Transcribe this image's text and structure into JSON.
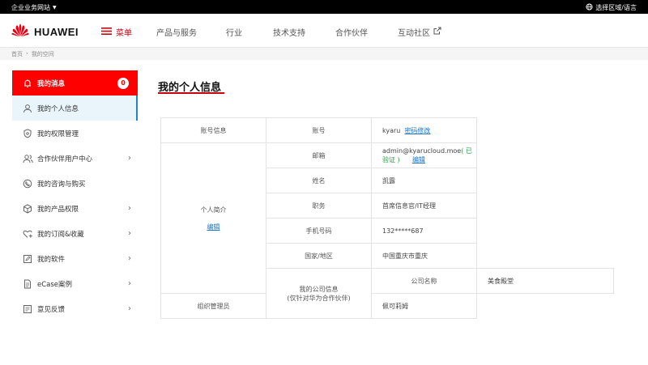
{
  "topbar": {
    "site_label": "企业业务网站",
    "region_label": "选择区域/语言"
  },
  "header": {
    "brand": "HUAWEI",
    "menu_label": "菜单",
    "nav": [
      {
        "label": "产品与服务"
      },
      {
        "label": "行业"
      },
      {
        "label": "技术支持"
      },
      {
        "label": "合作伙伴"
      },
      {
        "label": "互动社区"
      }
    ]
  },
  "breadcrumb": [
    "首页",
    "我的空间"
  ],
  "sidebar": {
    "items": [
      {
        "label": "我的消息",
        "badge": "0",
        "icon": "bell-icon"
      },
      {
        "label": "我的个人信息",
        "icon": "user-icon"
      },
      {
        "label": "我的权限管理",
        "icon": "shield-icon"
      },
      {
        "label": "合作伙伴用户中心",
        "icon": "partner-users-icon"
      },
      {
        "label": "我的咨询与购买",
        "icon": "phone-icon"
      },
      {
        "label": "我的产品权限",
        "icon": "cube-icon"
      },
      {
        "label": "我的订阅&收藏",
        "icon": "heart-plus-icon"
      },
      {
        "label": "我的软件",
        "icon": "edit-icon"
      },
      {
        "label": "eCase案例",
        "icon": "document-icon"
      },
      {
        "label": "意见反馈",
        "icon": "feedback-icon"
      }
    ]
  },
  "main": {
    "title": "我的个人信息",
    "account_section": {
      "title": "账号信息",
      "label": "账号",
      "value": "kyaru",
      "change_password": "密码修改"
    },
    "personal_section": {
      "title": "个人简介",
      "edit": "编辑",
      "rows": {
        "email_label": "邮箱",
        "email_value": "admin@kyarucloud.moe",
        "email_status": "( 已验证 )",
        "email_edit": "编辑",
        "name_label": "姓名",
        "name_value": "凯露",
        "position_label": "职务",
        "position_value": "首席信息官/IT经理",
        "phone_label": "手机号码",
        "phone_value": "132*****687",
        "region_label": "国家/地区",
        "region_value": "中国重庆市重庆"
      }
    },
    "company_section": {
      "title_line1": "我的公司信息",
      "title_line2": "(仅针对华为合作伙伴)",
      "company_label": "公司名称",
      "company_value": "美食殿堂",
      "admin_label": "组织管理员",
      "admin_value": "佩可莉姆"
    }
  },
  "colors": {
    "accent_red": "#c7000b",
    "sidebar_red": "#ff0000",
    "link_blue": "#1a73c4",
    "verified_green": "#2aa34a",
    "active_bg": "#e9f5fb"
  }
}
